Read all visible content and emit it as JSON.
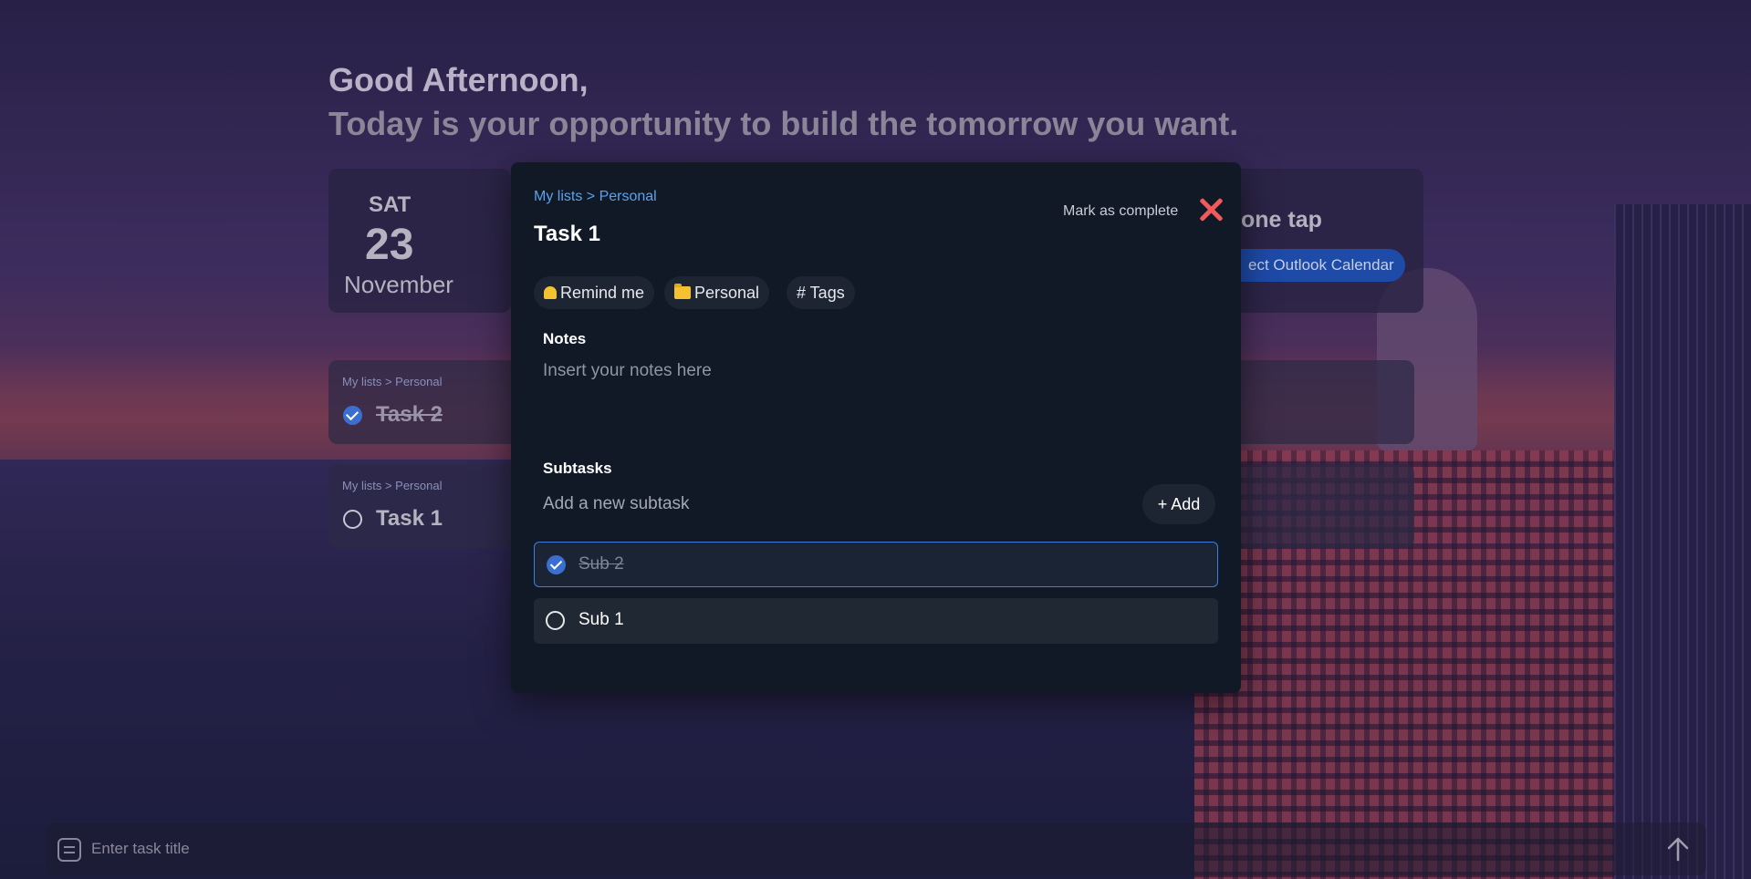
{
  "greeting": {
    "hello": "Good Afternoon,",
    "quote": "Today is your opportunity to build the tomorrow you want."
  },
  "date_card": {
    "day_of_week": "SAT",
    "day": "23",
    "month": "November"
  },
  "calendar_card": {
    "title": "one tap",
    "button_label": "ect Outlook Calendar"
  },
  "task_cards": [
    {
      "crumb": "My lists > Personal",
      "title": "Task 2",
      "completed": true
    },
    {
      "crumb": "My lists > Personal",
      "title": "Task 1",
      "completed": false
    }
  ],
  "input_bar": {
    "placeholder": "Enter task title"
  },
  "modal": {
    "crumb": "My lists > Personal",
    "title": "Task 1",
    "mark_complete": "Mark as complete",
    "chips": {
      "remind": "Remind me",
      "list": "Personal",
      "tags": "# Tags"
    },
    "notes_label": "Notes",
    "notes_placeholder": "Insert your notes here",
    "subtasks_label": "Subtasks",
    "subtask_placeholder": "Add a new subtask",
    "add_label": "+ Add",
    "subtasks": [
      {
        "title": "Sub 2",
        "completed": true
      },
      {
        "title": "Sub 1",
        "completed": false
      }
    ]
  },
  "colors": {
    "accent": "#3a6fd1",
    "link": "#5aa2f0",
    "close": "#f05a5a",
    "modal_bg": "#111927"
  }
}
